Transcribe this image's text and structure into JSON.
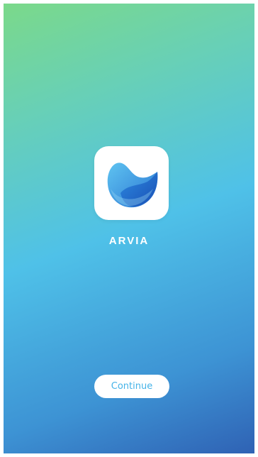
{
  "app": {
    "name": "ARVIA",
    "logo_icon": "arvia-wave-logo-icon"
  },
  "actions": {
    "continue_label": "Continue"
  },
  "colors": {
    "gradient_top": "#7bd98a",
    "gradient_middle": "#4fc1e8",
    "gradient_bottom": "#2f62b4",
    "button_text": "#45b3e8",
    "logo_primary": "#1f63c9",
    "logo_secondary": "#3ca6ea"
  }
}
